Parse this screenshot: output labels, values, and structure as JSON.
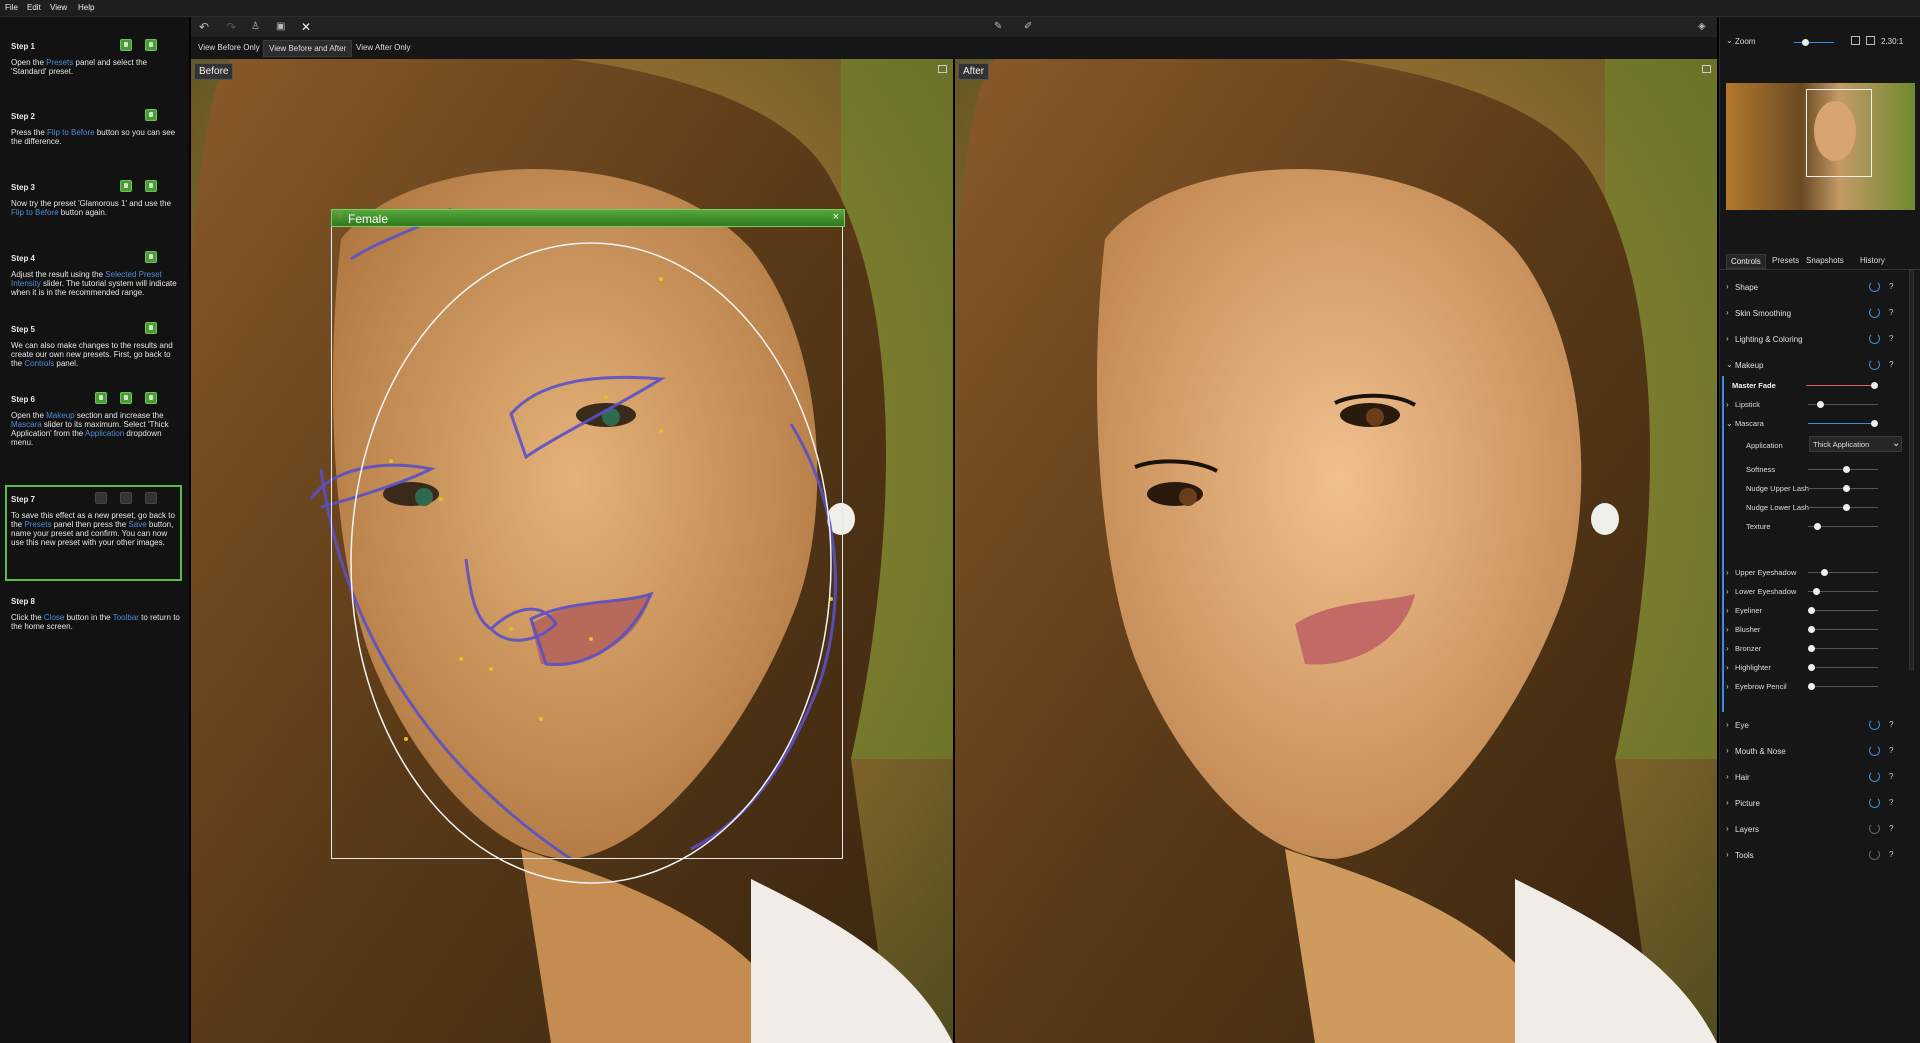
{
  "menu": [
    "File",
    "Edit",
    "View",
    "Help"
  ],
  "steps": [
    {
      "title": "Step 1",
      "text_parts": [
        [
          "Open the ",
          false
        ],
        [
          "Presets",
          true
        ],
        [
          " panel and select the 'Standard' preset.",
          false
        ]
      ],
      "icons": 2,
      "active": false
    },
    {
      "title": "Step 2",
      "text_parts": [
        [
          "Press the ",
          false
        ],
        [
          "Flip to Before",
          true
        ],
        [
          " button so you can see the difference.",
          false
        ]
      ],
      "icons": 1,
      "active": false
    },
    {
      "title": "Step 3",
      "text_parts": [
        [
          "Now try the preset 'Glamorous 1' and use the ",
          false
        ],
        [
          "Flip to Before",
          true
        ],
        [
          " button again.",
          false
        ]
      ],
      "icons": 2,
      "active": false
    },
    {
      "title": "Step 4",
      "text_parts": [
        [
          "Adjust the result using the ",
          false
        ],
        [
          "Selected Preset Intensity",
          true
        ],
        [
          " slider. The tutorial system will indicate when it is in the recommended range.",
          false
        ]
      ],
      "icons": 1,
      "active": false
    },
    {
      "title": "Step 5",
      "text_parts": [
        [
          "We can also make changes to the results and create our own new presets. First, go back to the ",
          false
        ],
        [
          "Controls",
          true
        ],
        [
          " panel.",
          false
        ]
      ],
      "icons": 1,
      "active": false
    },
    {
      "title": "Step 6",
      "text_parts": [
        [
          "Open the ",
          false
        ],
        [
          "Makeup",
          true
        ],
        [
          " section and increase the ",
          false
        ],
        [
          "Mascara",
          true
        ],
        [
          " slider to its maximum. Select 'Thick Application' from the ",
          false
        ],
        [
          "Application",
          true
        ],
        [
          " dropdown menu.",
          false
        ]
      ],
      "icons": 3,
      "active": false
    },
    {
      "title": "Step 7",
      "text_parts": [
        [
          "To save this effect as a new preset, go back to the ",
          false
        ],
        [
          "Presets",
          true
        ],
        [
          " panel then press the ",
          false
        ],
        [
          "Save",
          true
        ],
        [
          " button, name your preset and confirm. You can now use this new preset with your other images.",
          false
        ]
      ],
      "icons": 3,
      "active": true
    },
    {
      "title": "Step 8",
      "text_parts": [
        [
          "Click the ",
          false
        ],
        [
          "Close",
          true
        ],
        [
          " button in the ",
          false
        ],
        [
          "Toolbar",
          true
        ],
        [
          " to return to the home screen.",
          false
        ]
      ],
      "icons": 0,
      "active": false
    }
  ],
  "view_tabs": [
    "View Before Only",
    "View Before and After",
    "View After Only"
  ],
  "active_view_tab": 1,
  "before_label": "Before",
  "after_label": "After",
  "face_box_label": "Female",
  "face_box_close": "×",
  "zoom": {
    "label": "Zoom",
    "value": "2.30:1"
  },
  "panel_tabs": [
    "Controls",
    "Presets",
    "Snapshots",
    "History"
  ],
  "sections_top": [
    "Shape",
    "Skin Smoothing",
    "Lighting & Coloring"
  ],
  "makeup": {
    "label": "Makeup",
    "master_fade": {
      "label": "Master Fade",
      "value": 1.0
    },
    "lipstick": {
      "label": "Lipstick",
      "value": 0.15
    },
    "mascara": {
      "label": "Mascara",
      "value": 1.0
    },
    "application": {
      "label": "Application",
      "value": "Thick Application"
    },
    "mascara_sub": [
      {
        "label": "Softness",
        "value": 0.55
      },
      {
        "label": "Nudge Upper Lash",
        "value": 0.55
      },
      {
        "label": "Nudge Lower Lash",
        "value": 0.55
      },
      {
        "label": "Texture",
        "value": 0.1
      }
    ],
    "others": [
      {
        "label": "Upper Eyeshadow",
        "value": 0.2
      },
      {
        "label": "Lower Eyeshadow",
        "value": 0.08
      },
      {
        "label": "Eyeliner",
        "value": 0
      },
      {
        "label": "Blusher",
        "value": 0
      },
      {
        "label": "Bronzer",
        "value": 0
      },
      {
        "label": "Highlighter",
        "value": 0
      },
      {
        "label": "Eyebrow Pencil",
        "value": 0
      }
    ]
  },
  "sections_bottom": [
    {
      "label": "Eye",
      "power": true
    },
    {
      "label": "Mouth & Nose",
      "power": true
    },
    {
      "label": "Hair",
      "power": true
    },
    {
      "label": "Picture",
      "power": true
    },
    {
      "label": "Layers",
      "power": false
    },
    {
      "label": "Tools",
      "power": false
    }
  ],
  "help_glyph": "?",
  "colors": {
    "accent": "#3a8ddf",
    "step_active": "#5fb84a",
    "face_box": "#3e8f2a",
    "landmark": "#5a50c8"
  }
}
